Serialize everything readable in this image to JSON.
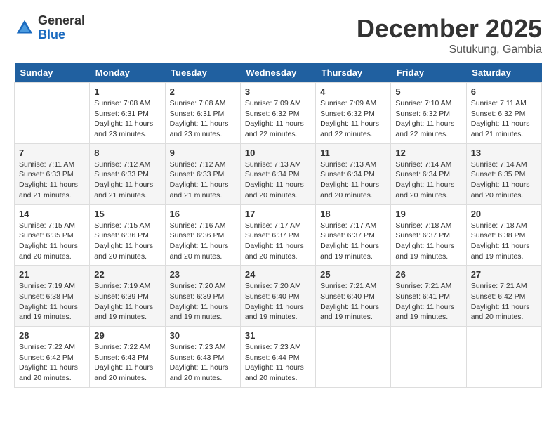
{
  "header": {
    "logo_general": "General",
    "logo_blue": "Blue",
    "month_title": "December 2025",
    "subtitle": "Sutukung, Gambia"
  },
  "days_of_week": [
    "Sunday",
    "Monday",
    "Tuesday",
    "Wednesday",
    "Thursday",
    "Friday",
    "Saturday"
  ],
  "weeks": [
    [
      {
        "day": "",
        "sunrise": "",
        "sunset": "",
        "daylight": ""
      },
      {
        "day": "1",
        "sunrise": "Sunrise: 7:08 AM",
        "sunset": "Sunset: 6:31 PM",
        "daylight": "Daylight: 11 hours and 23 minutes."
      },
      {
        "day": "2",
        "sunrise": "Sunrise: 7:08 AM",
        "sunset": "Sunset: 6:31 PM",
        "daylight": "Daylight: 11 hours and 23 minutes."
      },
      {
        "day": "3",
        "sunrise": "Sunrise: 7:09 AM",
        "sunset": "Sunset: 6:32 PM",
        "daylight": "Daylight: 11 hours and 22 minutes."
      },
      {
        "day": "4",
        "sunrise": "Sunrise: 7:09 AM",
        "sunset": "Sunset: 6:32 PM",
        "daylight": "Daylight: 11 hours and 22 minutes."
      },
      {
        "day": "5",
        "sunrise": "Sunrise: 7:10 AM",
        "sunset": "Sunset: 6:32 PM",
        "daylight": "Daylight: 11 hours and 22 minutes."
      },
      {
        "day": "6",
        "sunrise": "Sunrise: 7:11 AM",
        "sunset": "Sunset: 6:32 PM",
        "daylight": "Daylight: 11 hours and 21 minutes."
      }
    ],
    [
      {
        "day": "7",
        "sunrise": "Sunrise: 7:11 AM",
        "sunset": "Sunset: 6:33 PM",
        "daylight": "Daylight: 11 hours and 21 minutes."
      },
      {
        "day": "8",
        "sunrise": "Sunrise: 7:12 AM",
        "sunset": "Sunset: 6:33 PM",
        "daylight": "Daylight: 11 hours and 21 minutes."
      },
      {
        "day": "9",
        "sunrise": "Sunrise: 7:12 AM",
        "sunset": "Sunset: 6:33 PM",
        "daylight": "Daylight: 11 hours and 21 minutes."
      },
      {
        "day": "10",
        "sunrise": "Sunrise: 7:13 AM",
        "sunset": "Sunset: 6:34 PM",
        "daylight": "Daylight: 11 hours and 20 minutes."
      },
      {
        "day": "11",
        "sunrise": "Sunrise: 7:13 AM",
        "sunset": "Sunset: 6:34 PM",
        "daylight": "Daylight: 11 hours and 20 minutes."
      },
      {
        "day": "12",
        "sunrise": "Sunrise: 7:14 AM",
        "sunset": "Sunset: 6:34 PM",
        "daylight": "Daylight: 11 hours and 20 minutes."
      },
      {
        "day": "13",
        "sunrise": "Sunrise: 7:14 AM",
        "sunset": "Sunset: 6:35 PM",
        "daylight": "Daylight: 11 hours and 20 minutes."
      }
    ],
    [
      {
        "day": "14",
        "sunrise": "Sunrise: 7:15 AM",
        "sunset": "Sunset: 6:35 PM",
        "daylight": "Daylight: 11 hours and 20 minutes."
      },
      {
        "day": "15",
        "sunrise": "Sunrise: 7:15 AM",
        "sunset": "Sunset: 6:36 PM",
        "daylight": "Daylight: 11 hours and 20 minutes."
      },
      {
        "day": "16",
        "sunrise": "Sunrise: 7:16 AM",
        "sunset": "Sunset: 6:36 PM",
        "daylight": "Daylight: 11 hours and 20 minutes."
      },
      {
        "day": "17",
        "sunrise": "Sunrise: 7:17 AM",
        "sunset": "Sunset: 6:37 PM",
        "daylight": "Daylight: 11 hours and 20 minutes."
      },
      {
        "day": "18",
        "sunrise": "Sunrise: 7:17 AM",
        "sunset": "Sunset: 6:37 PM",
        "daylight": "Daylight: 11 hours and 19 minutes."
      },
      {
        "day": "19",
        "sunrise": "Sunrise: 7:18 AM",
        "sunset": "Sunset: 6:37 PM",
        "daylight": "Daylight: 11 hours and 19 minutes."
      },
      {
        "day": "20",
        "sunrise": "Sunrise: 7:18 AM",
        "sunset": "Sunset: 6:38 PM",
        "daylight": "Daylight: 11 hours and 19 minutes."
      }
    ],
    [
      {
        "day": "21",
        "sunrise": "Sunrise: 7:19 AM",
        "sunset": "Sunset: 6:38 PM",
        "daylight": "Daylight: 11 hours and 19 minutes."
      },
      {
        "day": "22",
        "sunrise": "Sunrise: 7:19 AM",
        "sunset": "Sunset: 6:39 PM",
        "daylight": "Daylight: 11 hours and 19 minutes."
      },
      {
        "day": "23",
        "sunrise": "Sunrise: 7:20 AM",
        "sunset": "Sunset: 6:39 PM",
        "daylight": "Daylight: 11 hours and 19 minutes."
      },
      {
        "day": "24",
        "sunrise": "Sunrise: 7:20 AM",
        "sunset": "Sunset: 6:40 PM",
        "daylight": "Daylight: 11 hours and 19 minutes."
      },
      {
        "day": "25",
        "sunrise": "Sunrise: 7:21 AM",
        "sunset": "Sunset: 6:40 PM",
        "daylight": "Daylight: 11 hours and 19 minutes."
      },
      {
        "day": "26",
        "sunrise": "Sunrise: 7:21 AM",
        "sunset": "Sunset: 6:41 PM",
        "daylight": "Daylight: 11 hours and 19 minutes."
      },
      {
        "day": "27",
        "sunrise": "Sunrise: 7:21 AM",
        "sunset": "Sunset: 6:42 PM",
        "daylight": "Daylight: 11 hours and 20 minutes."
      }
    ],
    [
      {
        "day": "28",
        "sunrise": "Sunrise: 7:22 AM",
        "sunset": "Sunset: 6:42 PM",
        "daylight": "Daylight: 11 hours and 20 minutes."
      },
      {
        "day": "29",
        "sunrise": "Sunrise: 7:22 AM",
        "sunset": "Sunset: 6:43 PM",
        "daylight": "Daylight: 11 hours and 20 minutes."
      },
      {
        "day": "30",
        "sunrise": "Sunrise: 7:23 AM",
        "sunset": "Sunset: 6:43 PM",
        "daylight": "Daylight: 11 hours and 20 minutes."
      },
      {
        "day": "31",
        "sunrise": "Sunrise: 7:23 AM",
        "sunset": "Sunset: 6:44 PM",
        "daylight": "Daylight: 11 hours and 20 minutes."
      },
      {
        "day": "",
        "sunrise": "",
        "sunset": "",
        "daylight": ""
      },
      {
        "day": "",
        "sunrise": "",
        "sunset": "",
        "daylight": ""
      },
      {
        "day": "",
        "sunrise": "",
        "sunset": "",
        "daylight": ""
      }
    ]
  ]
}
